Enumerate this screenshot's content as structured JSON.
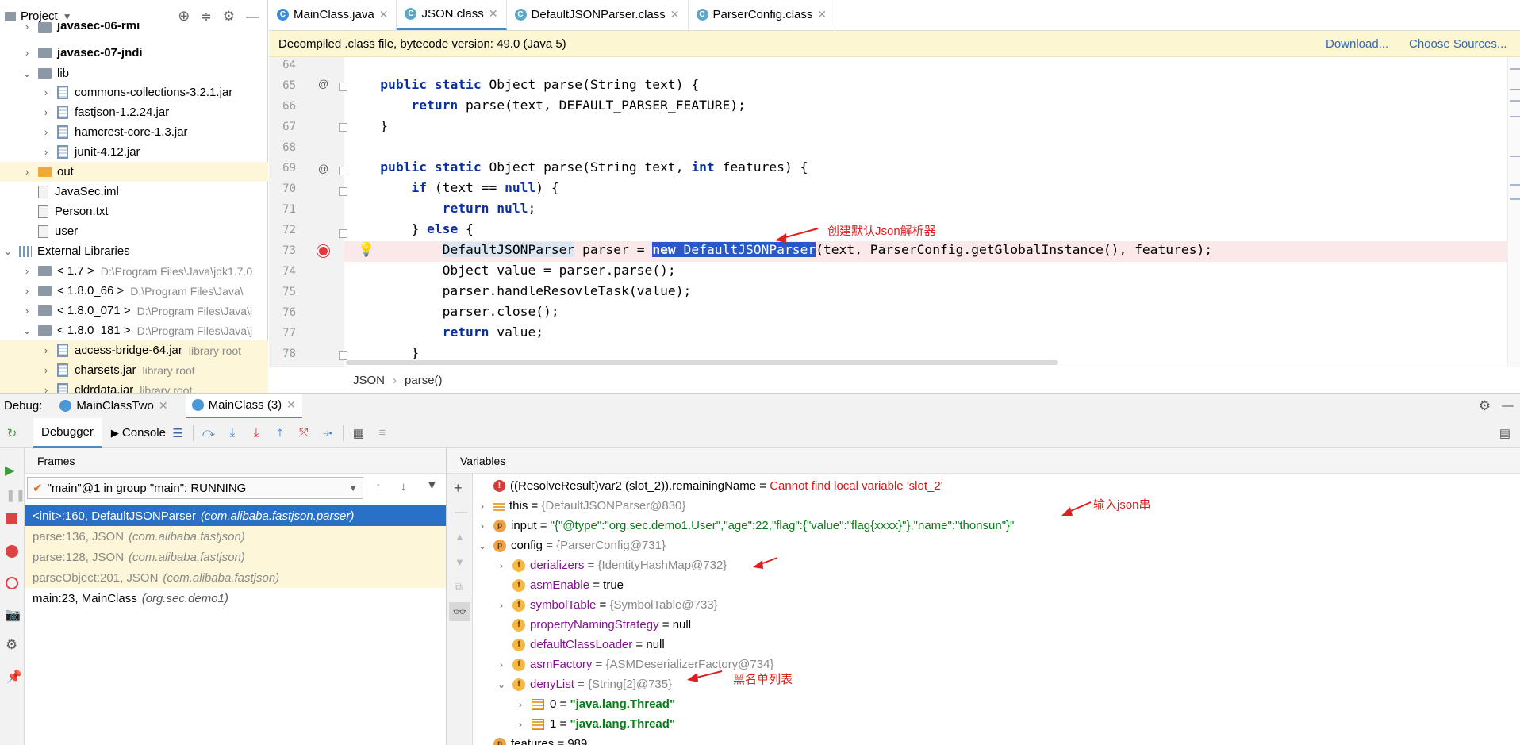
{
  "project": {
    "title": "Project",
    "tree": [
      {
        "label": "javasec-06-rmi",
        "kind": "module",
        "bold": true
      },
      {
        "label": "javasec-07-jndi",
        "kind": "module",
        "bold": true
      },
      {
        "label": "lib",
        "kind": "folder"
      },
      {
        "label": "commons-collections-3.2.1.jar",
        "kind": "jar"
      },
      {
        "label": "fastjson-1.2.24.jar",
        "kind": "jar"
      },
      {
        "label": "hamcrest-core-1.3.jar",
        "kind": "jar"
      },
      {
        "label": "junit-4.12.jar",
        "kind": "jar"
      },
      {
        "label": "out",
        "kind": "folder-orange"
      },
      {
        "label": "JavaSec.iml",
        "kind": "file"
      },
      {
        "label": "Person.txt",
        "kind": "file"
      },
      {
        "label": "user",
        "kind": "file"
      },
      {
        "label": "External Libraries",
        "kind": "lib"
      },
      {
        "label": "< 1.7 >",
        "hint": "D:\\Program Files\\Java\\jdk1.7.0"
      },
      {
        "label": "< 1.8.0_66 >",
        "hint": "D:\\Program Files\\Java\\"
      },
      {
        "label": "< 1.8.0_071 >",
        "hint": "D:\\Program Files\\Java\\j"
      },
      {
        "label": "< 1.8.0_181 >",
        "hint": "D:\\Program Files\\Java\\j"
      },
      {
        "label": "access-bridge-64.jar",
        "hint": "library root"
      },
      {
        "label": "charsets.jar",
        "hint": "library root"
      },
      {
        "label": "cldrdata.jar",
        "hint": "library root"
      }
    ]
  },
  "tabs": [
    {
      "label": "MainClass.java"
    },
    {
      "label": "JSON.class"
    },
    {
      "label": "DefaultJSONParser.class"
    },
    {
      "label": "ParserConfig.class"
    }
  ],
  "notice": {
    "text": "Decompiled .class file, bytecode version: 49.0 (Java 5)",
    "download": "Download...",
    "choose": "Choose Sources..."
  },
  "editor": {
    "line_numbers": [
      "64",
      "65",
      "66",
      "67",
      "68",
      "69",
      "70",
      "71",
      "72",
      "73",
      "74",
      "75",
      "76",
      "77",
      "78"
    ],
    "breadcrumb": [
      "JSON",
      "parse()"
    ],
    "annotation": "创建默认Json解析器"
  },
  "debug": {
    "label": "Debug:",
    "sessions": [
      "MainClassTwo",
      "MainClass (3)"
    ],
    "debugger_tab": "Debugger",
    "console_tab": "Console",
    "frames_title": "Frames",
    "thread": "\"main\"@1 in group \"main\": RUNNING",
    "frames": [
      {
        "method": "<init>:160, DefaultJSONParser",
        "pkg": "(com.alibaba.fastjson.parser)"
      },
      {
        "method": "parse:136, JSON",
        "pkg": "(com.alibaba.fastjson)"
      },
      {
        "method": "parse:128, JSON",
        "pkg": "(com.alibaba.fastjson)"
      },
      {
        "method": "parseObject:201, JSON",
        "pkg": "(com.alibaba.fastjson)"
      },
      {
        "method": "main:23, MainClass",
        "pkg": "(org.sec.demo1)"
      }
    ],
    "variables_title": "Variables",
    "vars": {
      "err_name": "((ResolveResult)var2 (slot_2)).remainingName",
      "err_val": "Cannot find local variable 'slot_2'",
      "this_name": "this",
      "this_val": "{DefaultJSONParser@830}",
      "input_name": "input",
      "input_val": "\"{\"@type\":\"org.sec.demo1.User\",\"age\":22,\"flag\":{\"value\":\"flag{xxxx}\"},\"name\":\"thonsun\"}\"",
      "config_name": "config",
      "config_val": "{ParserConfig@731}",
      "derializers_name": "derializers",
      "derializers_val": "{IdentityHashMap@732}",
      "asmEnable_name": "asmEnable",
      "asmEnable_val": "true",
      "symbolTable_name": "symbolTable",
      "symbolTable_val": "{SymbolTable@733}",
      "pns_name": "propertyNamingStrategy",
      "pns_val": "null",
      "dcl_name": "defaultClassLoader",
      "dcl_val": "null",
      "asmFactory_name": "asmFactory",
      "asmFactory_val": "{ASMDeserializerFactory@734}",
      "denyList_name": "denyList",
      "denyList_val": "{String[2]@735}",
      "deny0_name": "0",
      "deny0_val": "\"java.lang.Thread\"",
      "deny1_name": "1",
      "deny1_val": "\"java.lang.Thread\"",
      "features_name": "features",
      "features_val": "989"
    },
    "annotations": {
      "input": "输入json串",
      "deny": "黑名单列表"
    }
  }
}
